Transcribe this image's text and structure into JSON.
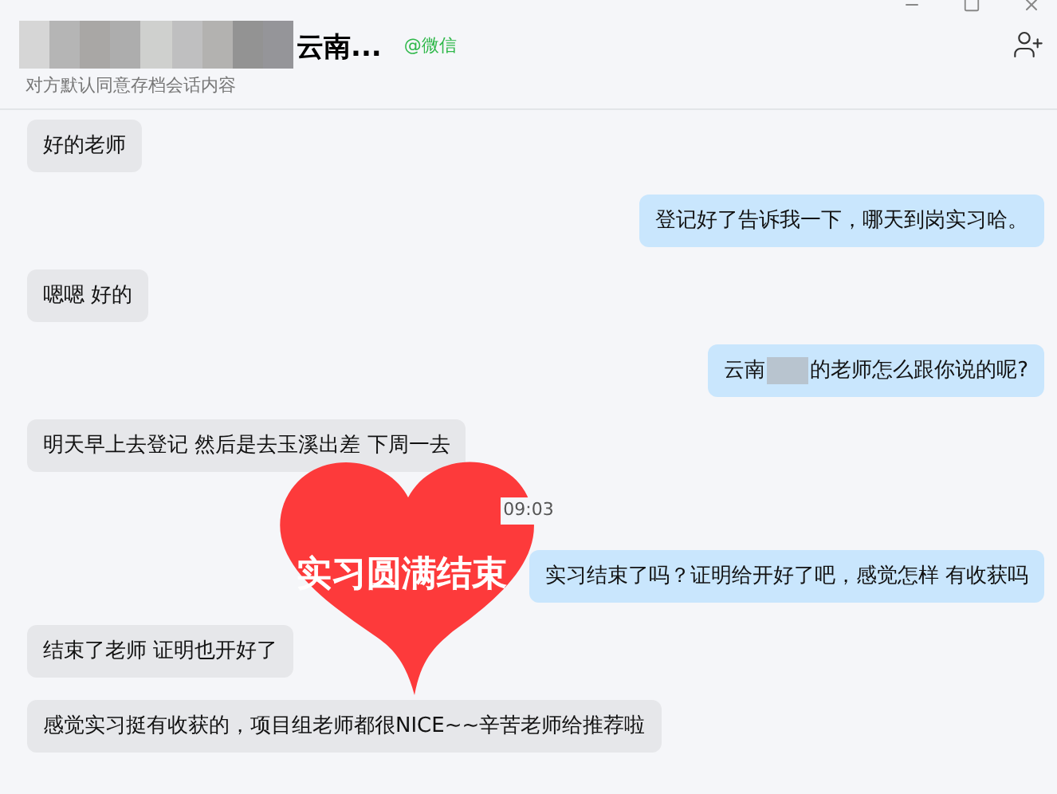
{
  "header": {
    "name_redacted": true,
    "title": "云南...",
    "source": "@微信",
    "subtitle": "对方默认同意存档会话内容"
  },
  "messages": [
    {
      "kind": "text",
      "outgoing": false,
      "parts": [
        {
          "kind": "text",
          "text": "好的老师"
        }
      ]
    },
    {
      "kind": "text",
      "outgoing": true,
      "parts": [
        {
          "kind": "text",
          "text": "登记好了告诉我一下，哪天到岗实习哈。"
        }
      ]
    },
    {
      "kind": "text",
      "outgoing": false,
      "parts": [
        {
          "kind": "text",
          "text": "嗯嗯 好的"
        }
      ]
    },
    {
      "kind": "text",
      "outgoing": true,
      "parts": [
        {
          "kind": "text",
          "text": "云南"
        },
        {
          "kind": "redaction"
        },
        {
          "kind": "text",
          "text": "的老师怎么跟你说的呢?"
        }
      ]
    },
    {
      "kind": "text",
      "outgoing": false,
      "parts": [
        {
          "kind": "text",
          "text": "明天早上去登记 然后是去玉溪出差 下周一去"
        }
      ]
    },
    {
      "kind": "time",
      "text": "09:03"
    },
    {
      "kind": "text",
      "outgoing": true,
      "parts": [
        {
          "kind": "text",
          "text": "实习结束了吗？证明给开好了吧，感觉怎样 有收获吗"
        }
      ]
    },
    {
      "kind": "text",
      "outgoing": false,
      "parts": [
        {
          "kind": "text",
          "text": "结束了老师 证明也开好了"
        }
      ]
    },
    {
      "kind": "text",
      "outgoing": false,
      "parts": [
        {
          "kind": "text",
          "text": "感觉实习挺有收获的，项目组老师都很NICE~~辛苦老师给推荐啦"
        }
      ]
    }
  ],
  "sticker": {
    "text": "实习圆满结束"
  }
}
